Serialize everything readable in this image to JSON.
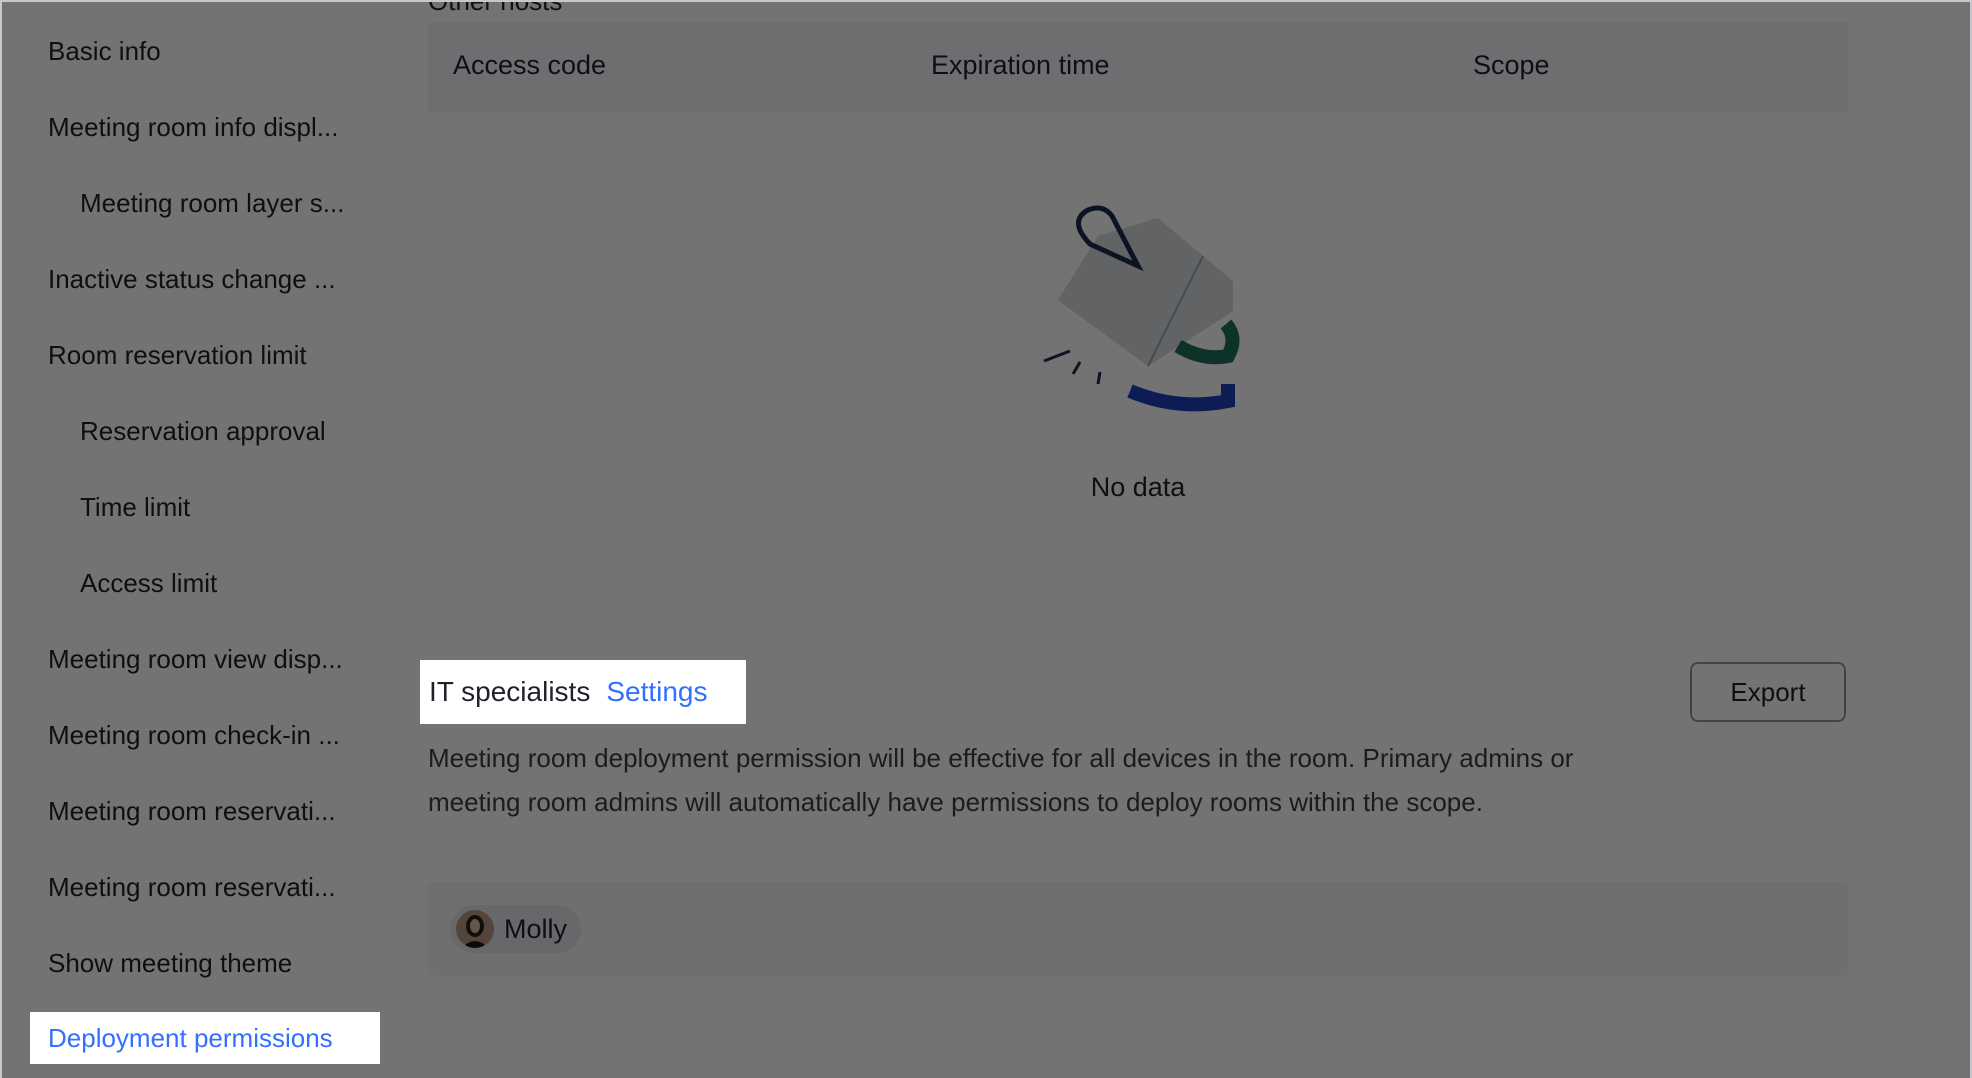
{
  "sidebar": {
    "items": [
      {
        "label": "Basic info",
        "sub": false
      },
      {
        "label": "Meeting room info displ...",
        "sub": false
      },
      {
        "label": "Meeting room layer s...",
        "sub": true
      },
      {
        "label": "Inactive status change ...",
        "sub": false
      },
      {
        "label": "Room reservation limit",
        "sub": false
      },
      {
        "label": "Reservation approval",
        "sub": true
      },
      {
        "label": "Time limit",
        "sub": true
      },
      {
        "label": "Access limit",
        "sub": true
      },
      {
        "label": "Meeting room view disp...",
        "sub": false
      },
      {
        "label": "Meeting room check-in ...",
        "sub": false
      },
      {
        "label": "Meeting room reservati...",
        "sub": false
      },
      {
        "label": "Meeting room reservati...",
        "sub": false
      },
      {
        "label": "Show meeting theme",
        "sub": false
      },
      {
        "label": "Deployment permissions",
        "sub": false,
        "active": true
      }
    ]
  },
  "access_table": {
    "section_label": "Other hosts",
    "columns": [
      "Access code",
      "Expiration time",
      "Scope"
    ],
    "empty_text": "No data"
  },
  "it_specialists": {
    "title": "IT specialists",
    "settings_label": "Settings",
    "export_label": "Export",
    "description": "Meeting room deployment permission will be effective for all devices in the room. Primary admins or meeting room admins will automatically have permissions to deploy rooms within the scope.",
    "members": [
      {
        "name": "Molly"
      }
    ]
  },
  "colors": {
    "accent": "#3370ff",
    "overlay": "rgba(0,0,0,0.55)"
  }
}
